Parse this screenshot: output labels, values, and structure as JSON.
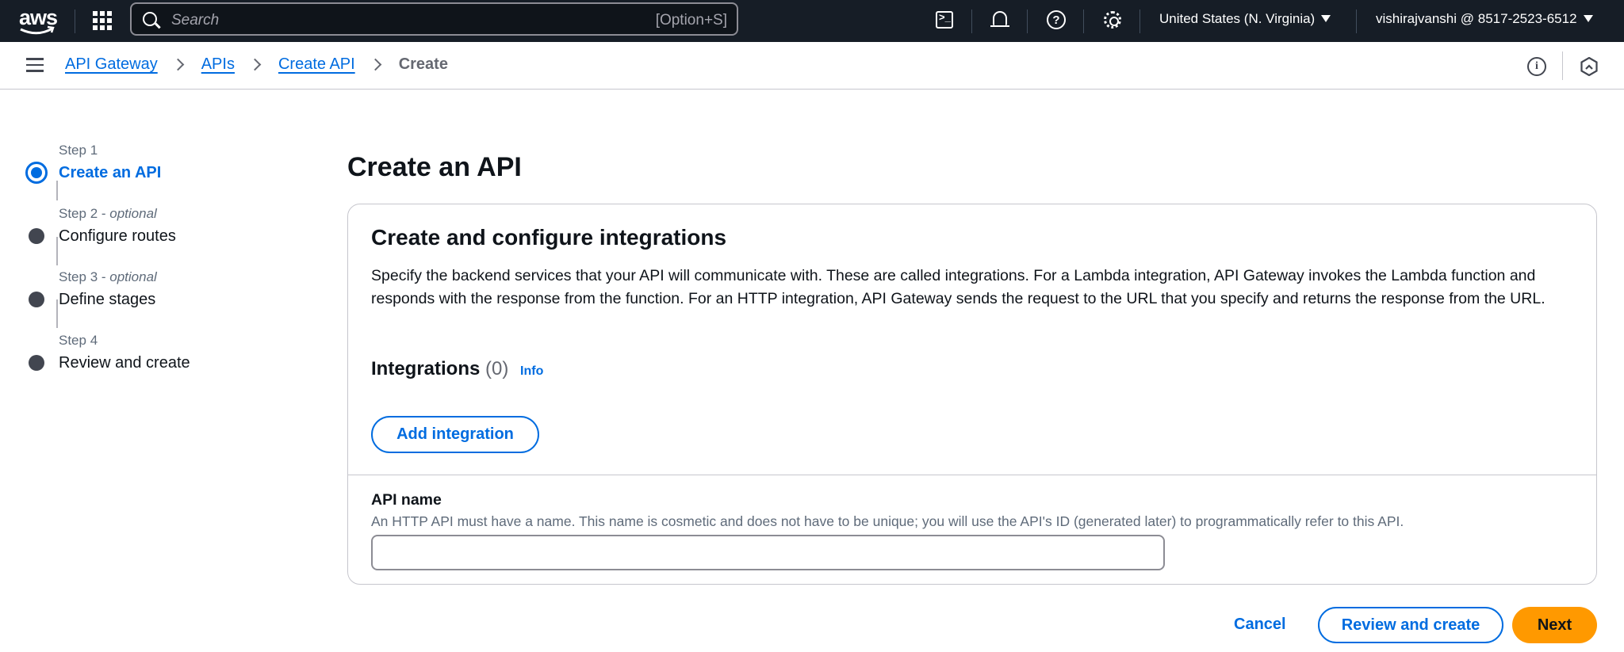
{
  "topnav": {
    "logo_text": "aws",
    "search_placeholder": "Search",
    "search_shortcut": "[Option+S]",
    "region": "United States (N. Virginia)",
    "account": "vishirajvanshi @ 8517-2523-6512",
    "icons": [
      "apps-grid-icon",
      "cloudshell-icon",
      "notifications-bell-icon",
      "help-icon",
      "settings-gear-icon"
    ]
  },
  "breadcrumb": {
    "items": [
      "API Gateway",
      "APIs",
      "Create API"
    ],
    "current": "Create"
  },
  "steps": [
    {
      "number": "Step 1",
      "optional": "",
      "label": "Create an API",
      "active": true
    },
    {
      "number": "Step 2",
      "optional": "optional",
      "label": "Configure routes",
      "active": false
    },
    {
      "number": "Step 3",
      "optional": "optional",
      "label": "Define stages",
      "active": false
    },
    {
      "number": "Step 4",
      "optional": "",
      "label": "Review and create",
      "active": false
    }
  ],
  "main": {
    "title": "Create an API",
    "panel_title": "Create and configure integrations",
    "panel_description": "Specify the backend services that your API will communicate with. These are called integrations. For a Lambda integration, API Gateway invokes the Lambda function and responds with the response from the function. For an HTTP integration, API Gateway sends the request to the URL that you specify and returns the response from the URL.",
    "integrations_heading": "Integrations",
    "integrations_count": "(0)",
    "info_link": "Info",
    "add_integration_label": "Add integration",
    "api_name_label": "API name",
    "api_name_description": "An HTTP API must have a name. This name is cosmetic and does not have to be unique; you will use the API's ID (generated later) to programmatically refer to this API.",
    "api_name_value": ""
  },
  "footer": {
    "cancel_label": "Cancel",
    "review_label": "Review and create",
    "next_label": "Next"
  },
  "colors": {
    "nav_bg": "#161d26",
    "link_blue": "#006ce0",
    "primary_orange": "#ff9900",
    "text_dark": "#0f141a"
  }
}
